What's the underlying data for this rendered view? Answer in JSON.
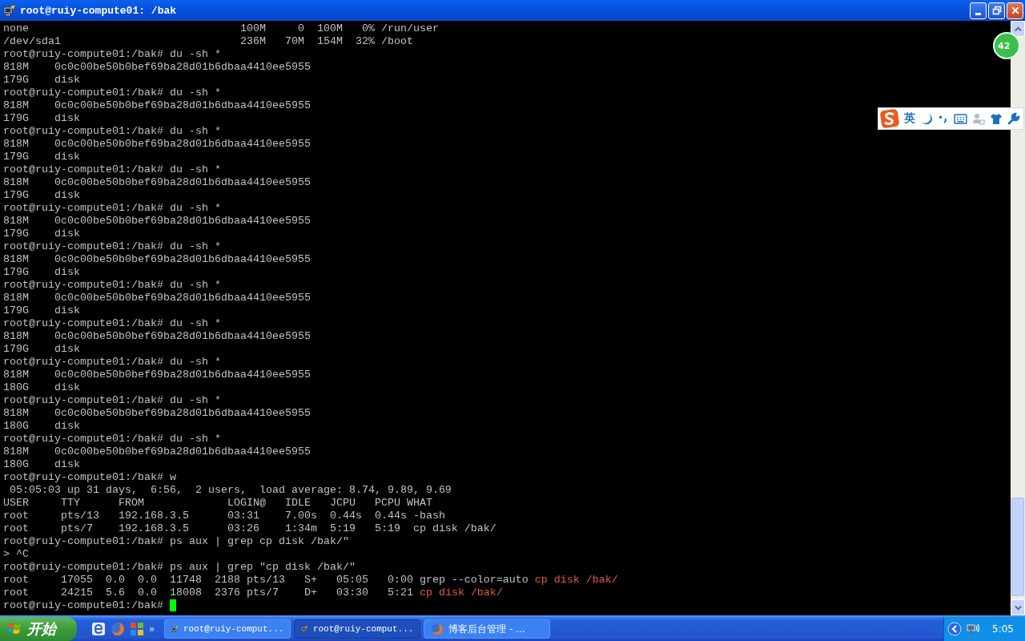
{
  "window": {
    "title": "root@ruiy-compute01: /bak"
  },
  "terminal": {
    "lines": [
      {
        "text": "none                                 100M     0  100M   0% /run/user"
      },
      {
        "text": "/dev/sda1                            236M   70M  154M  32% /boot"
      },
      {
        "text": "root@ruiy-compute01:/bak# du -sh *"
      },
      {
        "text": "818M    0c0c00be50b0bef69ba28d01b6dbaa4410ee5955"
      },
      {
        "text": "179G    disk"
      },
      {
        "text": "root@ruiy-compute01:/bak# du -sh *"
      },
      {
        "text": "818M    0c0c00be50b0bef69ba28d01b6dbaa4410ee5955"
      },
      {
        "text": "179G    disk"
      },
      {
        "text": "root@ruiy-compute01:/bak# du -sh *"
      },
      {
        "text": "818M    0c0c00be50b0bef69ba28d01b6dbaa4410ee5955"
      },
      {
        "text": "179G    disk"
      },
      {
        "text": "root@ruiy-compute01:/bak# du -sh *"
      },
      {
        "text": "818M    0c0c00be50b0bef69ba28d01b6dbaa4410ee5955"
      },
      {
        "text": "179G    disk"
      },
      {
        "text": "root@ruiy-compute01:/bak# du -sh *"
      },
      {
        "text": "818M    0c0c00be50b0bef69ba28d01b6dbaa4410ee5955"
      },
      {
        "text": "179G    disk"
      },
      {
        "text": "root@ruiy-compute01:/bak# du -sh *"
      },
      {
        "text": "818M    0c0c00be50b0bef69ba28d01b6dbaa4410ee5955"
      },
      {
        "text": "179G    disk"
      },
      {
        "text": "root@ruiy-compute01:/bak# du -sh *"
      },
      {
        "text": "818M    0c0c00be50b0bef69ba28d01b6dbaa4410ee5955"
      },
      {
        "text": "179G    disk"
      },
      {
        "text": "root@ruiy-compute01:/bak# du -sh *"
      },
      {
        "text": "818M    0c0c00be50b0bef69ba28d01b6dbaa4410ee5955"
      },
      {
        "text": "179G    disk"
      },
      {
        "text": "root@ruiy-compute01:/bak# du -sh *"
      },
      {
        "text": "818M    0c0c00be50b0bef69ba28d01b6dbaa4410ee5955"
      },
      {
        "text": "180G    disk"
      },
      {
        "text": "root@ruiy-compute01:/bak# du -sh *"
      },
      {
        "text": "818M    0c0c00be50b0bef69ba28d01b6dbaa4410ee5955"
      },
      {
        "text": "180G    disk"
      },
      {
        "text": "root@ruiy-compute01:/bak# du -sh *"
      },
      {
        "text": "818M    0c0c00be50b0bef69ba28d01b6dbaa4410ee5955"
      },
      {
        "text": "180G    disk"
      },
      {
        "text": "root@ruiy-compute01:/bak# w"
      },
      {
        "text": " 05:05:03 up 31 days,  6:56,  2 users,  load average: 8.74, 9.89, 9.69"
      },
      {
        "text": "USER     TTY      FROM             LOGIN@   IDLE   JCPU   PCPU WHAT"
      },
      {
        "text": "root     pts/13   192.168.3.5      03:31    7.00s  0.44s  0.44s -bash"
      },
      {
        "text": "root     pts/7    192.168.3.5      03:26    1:34m  5:19   5:19  cp disk /bak/"
      },
      {
        "text": "root@ruiy-compute01:/bak# ps aux | grep cp disk /bak/\""
      },
      {
        "text": "> ^C"
      },
      {
        "text": "root@ruiy-compute01:/bak# ps aux | grep \"cp disk /bak/\""
      },
      {
        "text": "root     17055  0.0  0.0  11748  2188 pts/13   S+   05:05   0:00 grep --color=auto ",
        "match": "cp disk /bak/"
      },
      {
        "text": "root     24215  5.6  0.0  18008  2376 pts/7    D+   03:30   5:21 ",
        "match": "cp disk /bak/"
      },
      {
        "text": "root@ruiy-compute01:/bak# "
      }
    ]
  },
  "floating_badge": {
    "text": "42"
  },
  "ime_toolbar": {
    "mode": "英"
  },
  "taskbar": {
    "start": "开始",
    "quick_launch_more": "»",
    "tasks": [
      {
        "kind": "terminal",
        "label": "root@ruiy-comput...",
        "selected": false
      },
      {
        "kind": "terminal",
        "label": "root@ruiy-comput...",
        "selected": true
      },
      {
        "kind": "browser",
        "label": "博客后台管理 - ...",
        "selected": false
      }
    ],
    "clock": "5:05"
  }
}
